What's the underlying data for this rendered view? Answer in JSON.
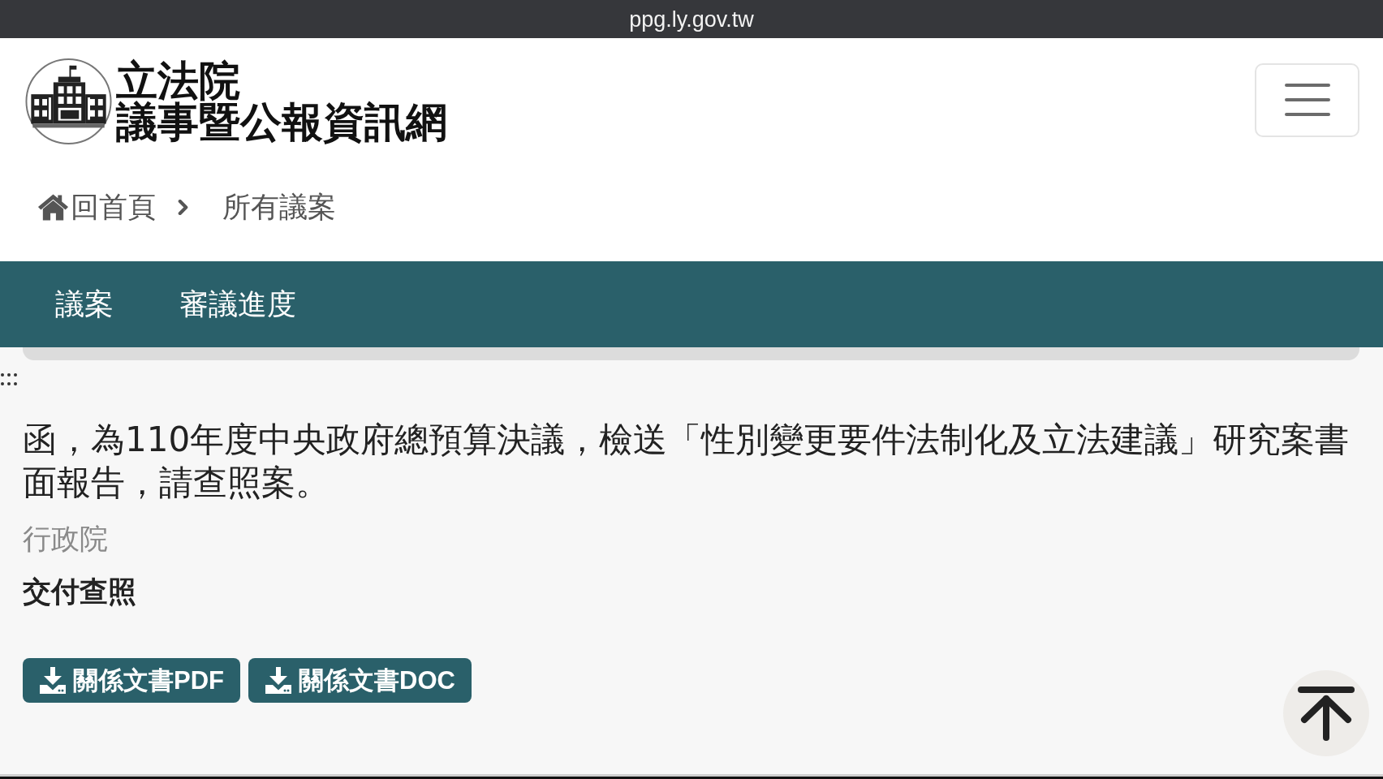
{
  "address_bar": {
    "url": "ppg.ly.gov.tw"
  },
  "header": {
    "title_lines": [
      "立法院",
      "議事暨公報資訊網"
    ]
  },
  "breadcrumb": [
    {
      "kind": "home",
      "label": "回首頁"
    },
    {
      "kind": "current",
      "label": "所有議案"
    }
  ],
  "tabs": [
    {
      "label": "議案",
      "selected": false
    },
    {
      "label": "審議進度",
      "selected": false
    }
  ],
  "bill": {
    "title": "函，為110年度中央政府總預算決議，檢送「性別變更要件法制化及立法建議」研究案書面報告，請查照案。",
    "proposer": "行政院",
    "status": "交付查照",
    "documents": [
      {
        "label": "關係文書PDF"
      },
      {
        "label": "關係文書DOC"
      }
    ]
  }
}
